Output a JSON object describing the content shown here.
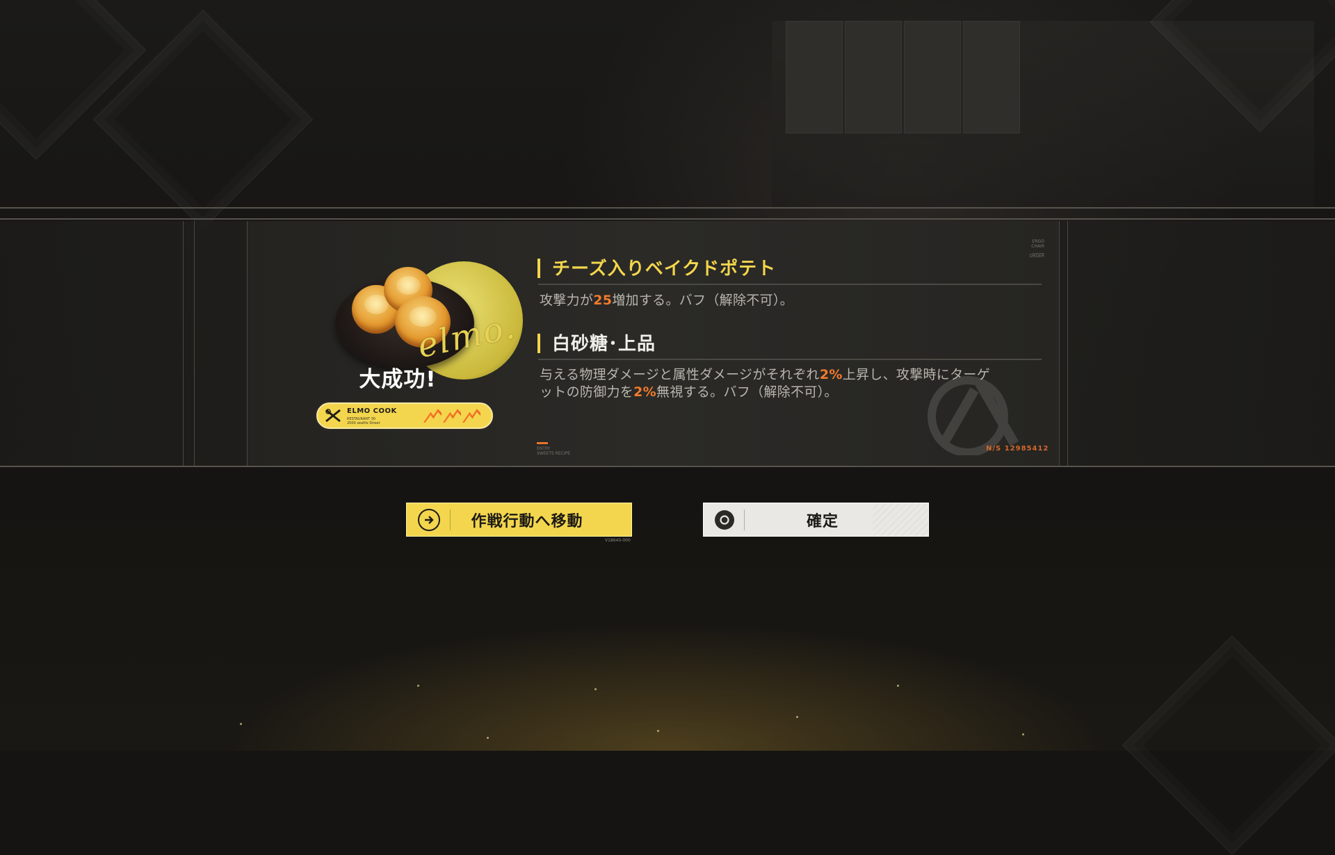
{
  "food": {
    "logo_script": "elmo.",
    "result_text": "大成功!"
  },
  "badge": {
    "title": "ELMO COOK",
    "subtitle_line1": "RESTAURANT 30",
    "subtitle_line2": "2000 seafile Street",
    "arrow_count": 3,
    "colors": {
      "fill": "#f3d64d",
      "arrows": "#ee6a24"
    }
  },
  "effects": [
    {
      "name": "チーズ入りベイクドポテト",
      "desc_parts": [
        "攻撃力が",
        "25",
        "増加する。バフ（解除不可）。"
      ]
    },
    {
      "name": "白砂糖･上品",
      "desc_line1_parts": [
        "与える物理ダメージと属性ダメージがそれぞれ",
        "2%",
        "上昇し、攻撃時にターゲ"
      ],
      "desc_line2_parts": [
        "ットの防御力を",
        "2%",
        "無視する。バフ（解除不可）。"
      ]
    }
  ],
  "panel": {
    "corner_note_line1": "ERGO CHAIR",
    "corner_note_line2": "______  ORDER",
    "small_caption_line1": "ENTRY",
    "small_caption_line2": "SWEETS RECIPE",
    "serial": "N/S 12985412"
  },
  "buttons": {
    "go_label": "作戦行動へ移動",
    "go_icon": "arrow-right-circle-icon",
    "ok_label": "確定",
    "ok_icon": "circle-target-icon",
    "code": "V18640-000"
  },
  "colors": {
    "accent_yellow": "#f3d64d",
    "highlight_orange": "#f27a2c",
    "serial_orange": "#d4682d"
  }
}
